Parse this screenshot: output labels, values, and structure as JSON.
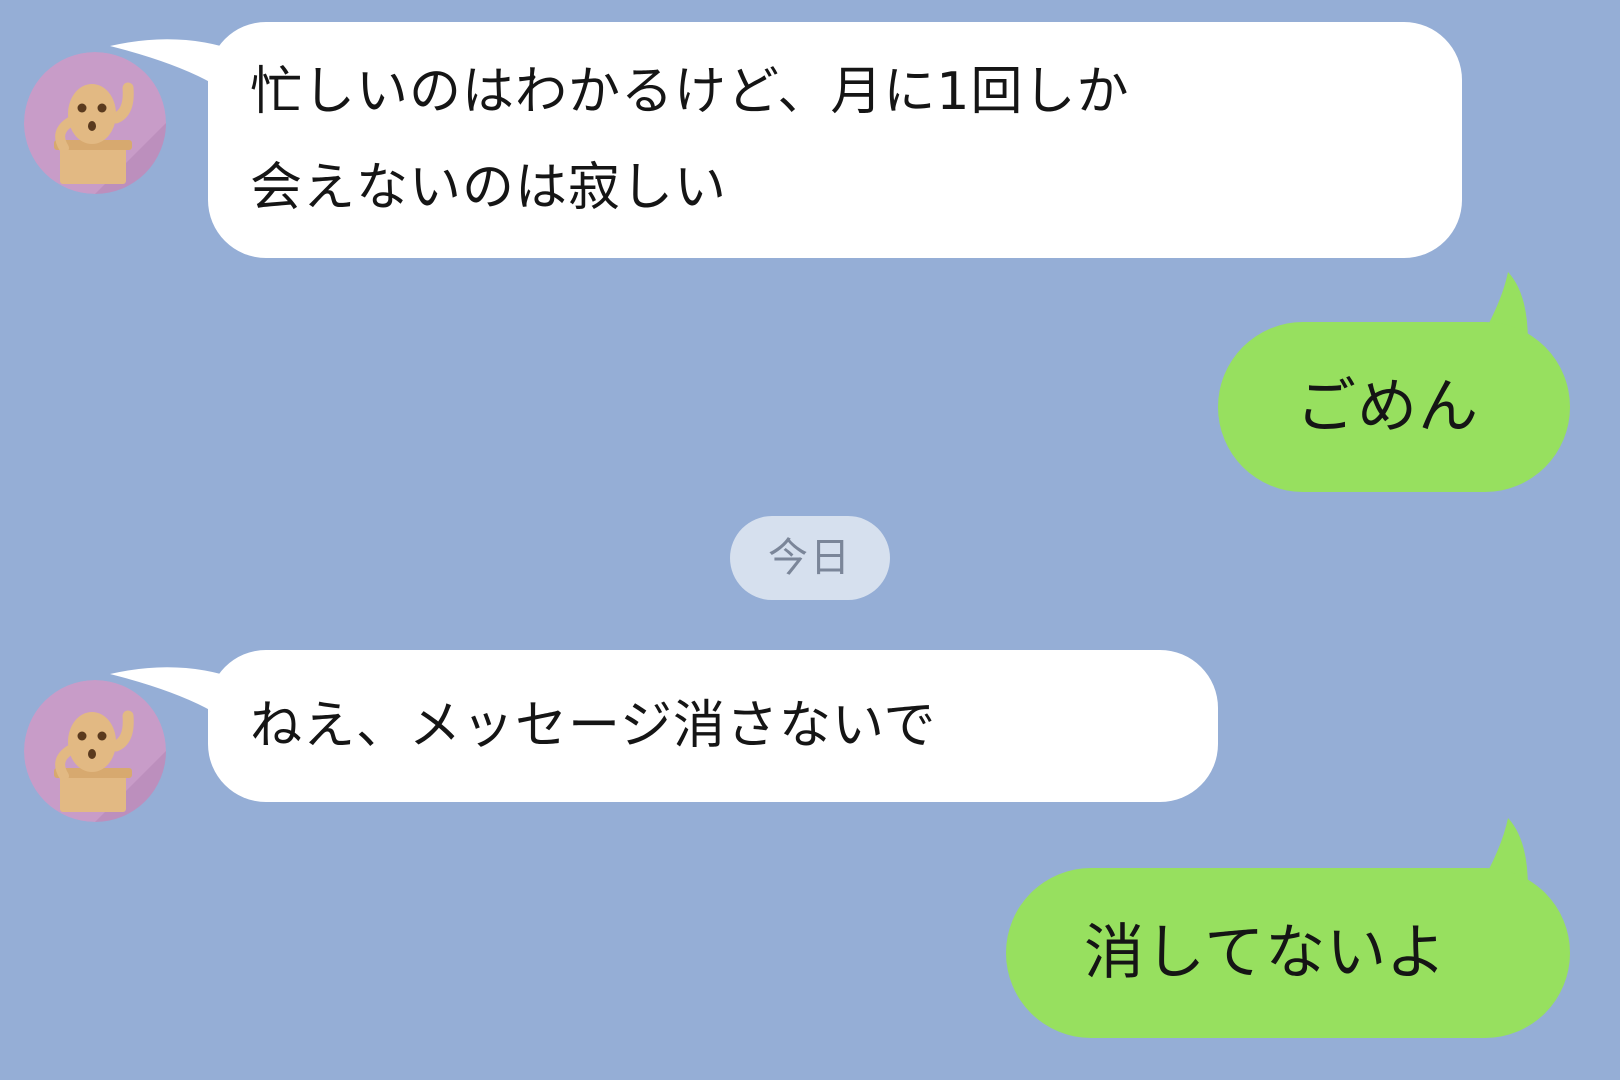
{
  "colors": {
    "background": "#95aed6",
    "incoming_bubble": "#ffffff",
    "outgoing_bubble": "#97e05f",
    "date_chip": "#d6e0ee",
    "avatar_circle": "#c89cc8"
  },
  "messages": [
    {
      "direction": "incoming",
      "avatar": "haniwa-avatar",
      "lines": [
        "忙しいのはわかるけど、月に1回しか",
        "会えないのは寂しい"
      ]
    },
    {
      "direction": "outgoing",
      "lines": [
        "ごめん"
      ]
    },
    {
      "direction": "incoming",
      "avatar": "haniwa-avatar",
      "lines": [
        "ねえ、メッセージ消さないで"
      ]
    },
    {
      "direction": "outgoing",
      "lines": [
        "消してないよ"
      ]
    }
  ],
  "date_separator": {
    "label": "今日"
  }
}
